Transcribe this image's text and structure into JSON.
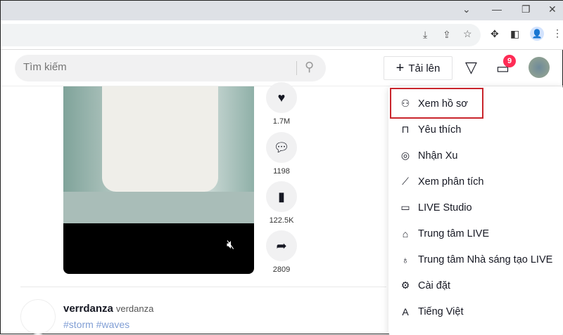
{
  "browser": {
    "icons": [
      "chevron-down-icon",
      "minimize-icon",
      "restore-icon",
      "close-icon",
      "install-icon",
      "share-icon",
      "star-icon",
      "extensions-icon",
      "sidepanel-icon",
      "profile-icon",
      "menu-dots-icon"
    ]
  },
  "header": {
    "search_placeholder": "Tìm kiếm",
    "upload_label": "Tải lên",
    "inbox_badge": "9"
  },
  "video": {
    "actions": [
      {
        "icon": "heart-icon",
        "count": "1.7M"
      },
      {
        "icon": "comment-icon",
        "count": "1198"
      },
      {
        "icon": "bookmark-icon",
        "count": "122.5K"
      },
      {
        "icon": "share-icon",
        "count": "2809"
      }
    ]
  },
  "next_post": {
    "username": "verrdanza",
    "nickname": "verdanza",
    "hashtags": "#storm #waves"
  },
  "menu": {
    "items": [
      {
        "label": "Xem hồ sơ",
        "icon": "person-icon",
        "glyph": "⚇"
      },
      {
        "label": "Yêu thích",
        "icon": "bookmark-icon",
        "glyph": "⊓"
      },
      {
        "label": "Nhận Xu",
        "icon": "coin-icon",
        "glyph": "◎"
      },
      {
        "label": "Xem phân tích",
        "icon": "analytics-icon",
        "glyph": "⟋"
      },
      {
        "label": "LIVE Studio",
        "icon": "live-camera-icon",
        "glyph": "▭"
      },
      {
        "label": "Trung tâm LIVE",
        "icon": "live-home-icon",
        "glyph": "⌂"
      },
      {
        "label": "Trung tâm Nhà sáng tạo LIVE",
        "icon": "lightbulb-icon",
        "glyph": "♁"
      },
      {
        "label": "Cài đặt",
        "icon": "gear-icon",
        "glyph": "⚙"
      },
      {
        "label": "Tiếng Việt",
        "icon": "language-icon",
        "glyph": "A"
      }
    ]
  },
  "highlight_color": "#c9252c"
}
